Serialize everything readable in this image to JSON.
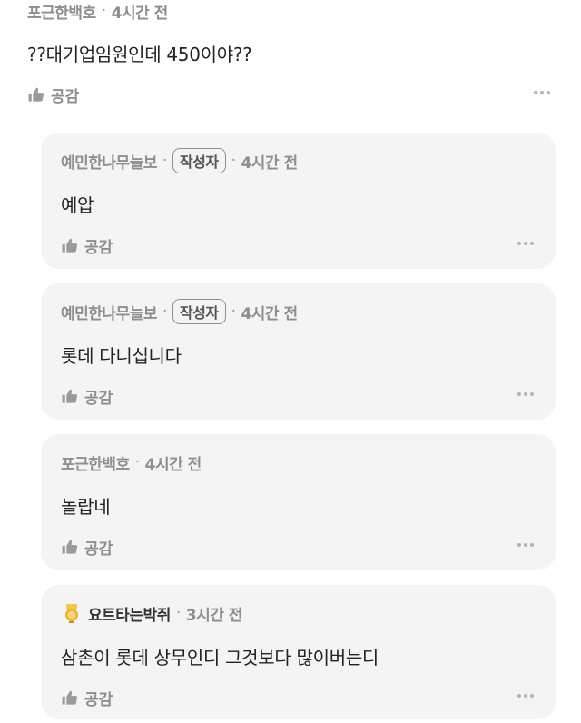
{
  "main_comment": {
    "author": "포근한백호",
    "separator": "·",
    "time": "4시간 전",
    "text": "??대기업임원인데 450이야??",
    "like_label": "공감"
  },
  "replies": [
    {
      "author": "예민한나무늘보",
      "separator": "·",
      "badge": "작성자",
      "separator2": "·",
      "time": "4시간 전",
      "text": "예압",
      "like_label": "공감"
    },
    {
      "author": "예민한나무늘보",
      "separator": "·",
      "badge": "작성자",
      "separator2": "·",
      "time": "4시간 전",
      "text": "롯데 다니십니다",
      "like_label": "공감"
    },
    {
      "author": "포근한백호",
      "separator": "·",
      "time": "4시간 전",
      "text": "놀랍네",
      "like_label": "공감"
    },
    {
      "author": "요트타는박쥐",
      "rank_icon": "gold-rank-badge-icon",
      "separator": "·",
      "time": "3시간 전",
      "text": "삼촌이 롯데 상무인디 그것보다 많이버는디",
      "like_label": "공감"
    }
  ],
  "colors": {
    "reply_bg": "#f4f4f5",
    "meta_text": "#8e8e8e",
    "body_text": "#222222",
    "rank_gold": "#e8b23a"
  }
}
